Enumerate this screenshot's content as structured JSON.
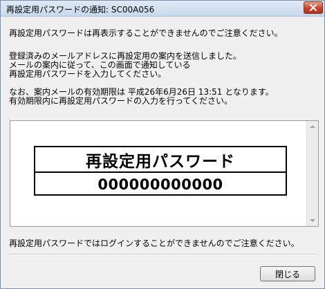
{
  "window": {
    "title": "再設定用パスワードの通知: SC00A056"
  },
  "messages": {
    "notice_top": "再設定用パスワードは再表示することができませんのでご注意ください。",
    "sent_line1": "登録済みのメールアドレスに再設定用の案内を送信しました。",
    "sent_line2": "メールの案内に従って、この画面で通知している",
    "sent_line3": "再設定用パスワードを入力してください。",
    "expiry_line1": "なお、案内メールの有効期限は 平成26年6月26日  13:51 となります。",
    "expiry_line2": "有効期限内に再設定用パスワードの入力を行ってください。",
    "notice_bottom": "再設定用パスワードではログインすることができませんのでご注意ください。"
  },
  "password_box": {
    "heading": "再設定用パスワード",
    "value": "000000000000"
  },
  "buttons": {
    "close_label": "閉じる"
  },
  "icons": {
    "titlebar_close": "close-icon",
    "scroll_up": "scroll-up-arrow-icon",
    "scroll_down": "scroll-down-arrow-icon"
  }
}
